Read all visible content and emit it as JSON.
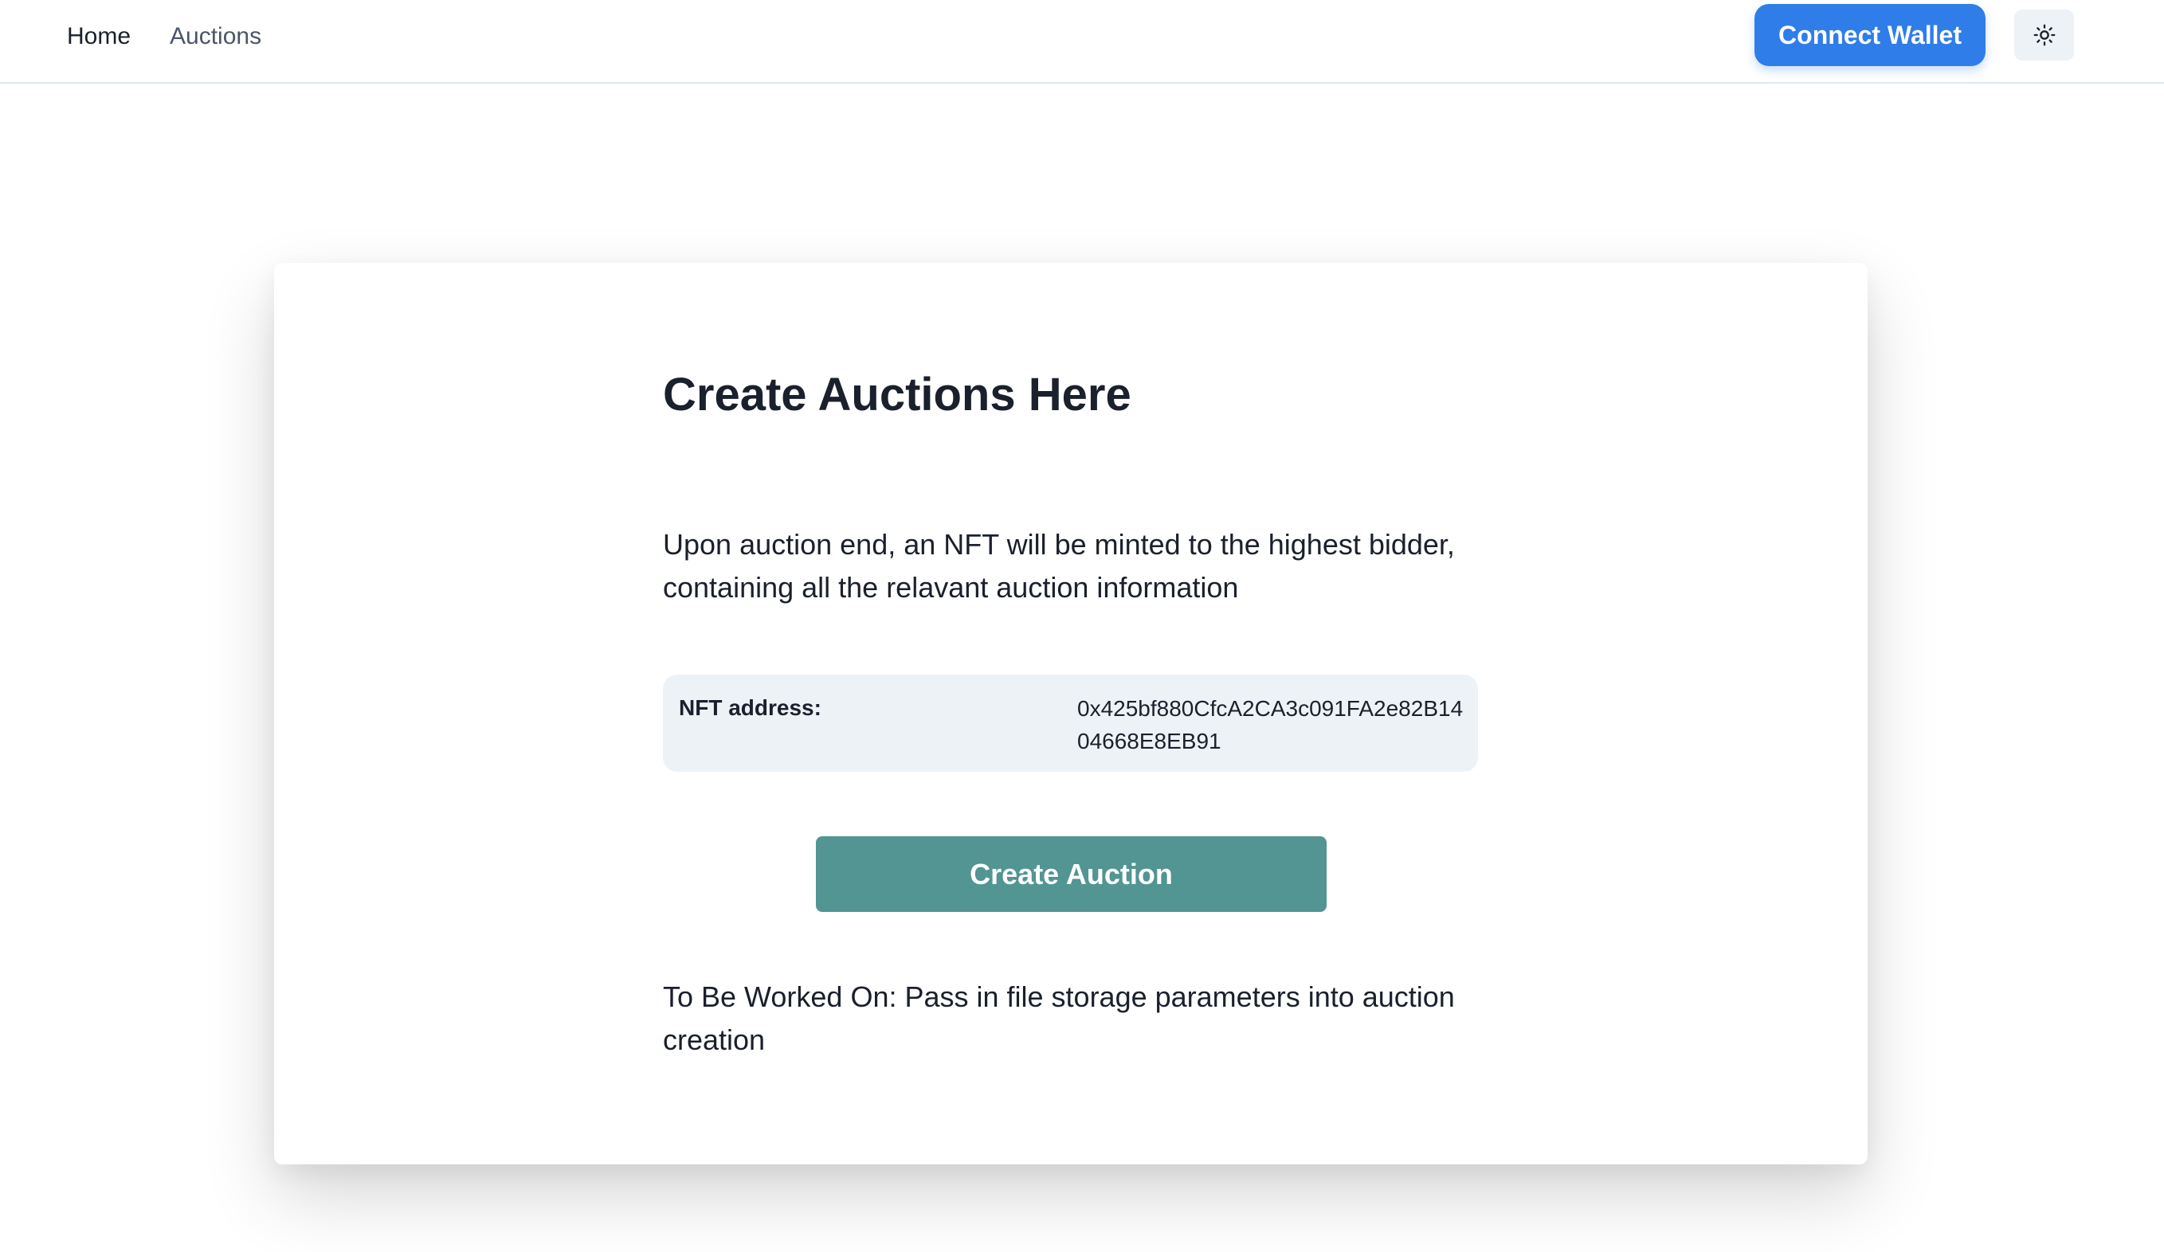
{
  "nav": {
    "home_label": "Home",
    "auctions_label": "Auctions",
    "connect_wallet_label": "Connect Wallet",
    "theme_toggle_icon": "sun-icon"
  },
  "main": {
    "title": "Create Auctions Here",
    "description": "Upon auction end, an NFT will be minted to the highest bidder, containing all the relavant auction information",
    "nft_label": "NFT address:",
    "nft_address": "0x425bf880CfcA2CA3c091FA2e82B1404668E8EB91",
    "create_button_label": "Create Auction",
    "todo_note": "To Be Worked On: Pass in file storage parameters into auction creation"
  },
  "colors": {
    "accent_blue": "#2f7de9",
    "button_teal": "#529592",
    "info_box_bg": "#edf2f7"
  }
}
